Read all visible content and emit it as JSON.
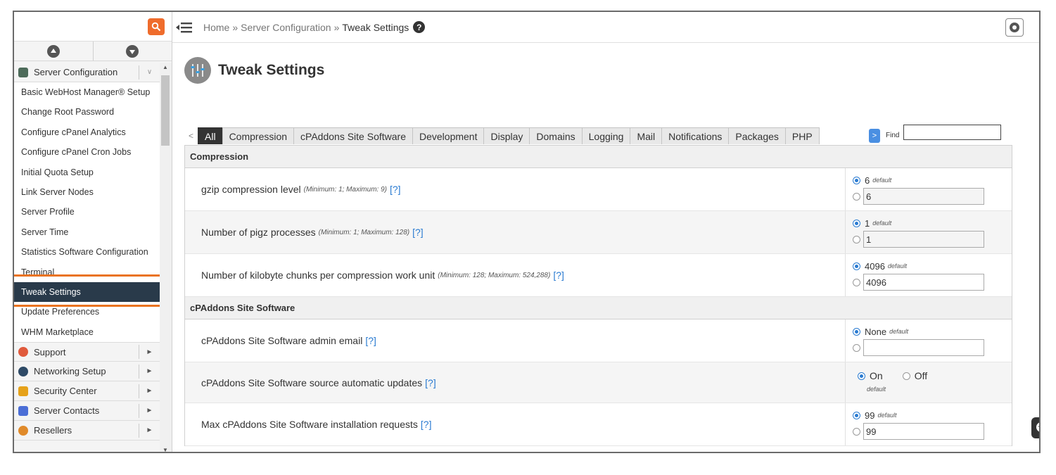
{
  "sidebar": {
    "search_placeholder": "",
    "category_open": "Server Configuration",
    "items": [
      "Basic WebHost Manager® Setup",
      "Change Root Password",
      "Configure cPanel Analytics",
      "Configure cPanel Cron Jobs",
      "Initial Quota Setup",
      "Link Server Nodes",
      "Server Profile",
      "Server Time",
      "Statistics Software Configuration",
      "Terminal",
      "Tweak Settings",
      "Update Preferences",
      "WHM Marketplace"
    ],
    "active_item": "Tweak Settings",
    "categories": [
      "Support",
      "Networking Setup",
      "Security Center",
      "Server Contacts",
      "Resellers"
    ]
  },
  "breadcrumb": {
    "home": "Home",
    "separator": "»",
    "level1": "Server Configuration",
    "current": "Tweak Settings"
  },
  "page": {
    "title": "Tweak Settings"
  },
  "tabs": {
    "items": [
      "All",
      "Compression",
      "cPAddons Site Software",
      "Development",
      "Display",
      "Domains",
      "Logging",
      "Mail",
      "Notifications",
      "Packages",
      "PHP"
    ],
    "active": "All",
    "find_label": "Find",
    "find_value": "",
    "prev_glyph": "<",
    "next_glyph": ">"
  },
  "sections": [
    {
      "title": "Compression",
      "rows": [
        {
          "label": "gzip compression level",
          "hint": "(Minimum: 1; Maximum: 9)",
          "help": "[?]",
          "default_value": "6",
          "default_tag": "default",
          "input_value": "6"
        },
        {
          "label": "Number of pigz processes",
          "hint": "(Minimum: 1; Maximum: 128)",
          "help": "[?]",
          "default_value": "1",
          "default_tag": "default",
          "input_value": "1"
        },
        {
          "label": "Number of kilobyte chunks per compression work unit",
          "hint": "(Minimum: 128; Maximum: 524,288)",
          "help": "[?]",
          "default_value": "4096",
          "default_tag": "default",
          "input_value": "4096"
        }
      ]
    },
    {
      "title": "cPAddons Site Software",
      "rows": [
        {
          "label": "cPAddons Site Software admin email",
          "help": "[?]",
          "default_value": "None",
          "default_tag": "default",
          "input_value": ""
        },
        {
          "label": "cPAddons Site Software source automatic updates",
          "help": "[?]",
          "on_label": "On",
          "off_label": "Off",
          "default_tag": "default"
        },
        {
          "label": "Max cPAddons Site Software installation requests",
          "help": "[?]",
          "default_value": "99",
          "default_tag": "default",
          "input_value": "99"
        }
      ]
    }
  ],
  "colors": {
    "accent": "#ef6c2c",
    "active_nav": "#293a4a",
    "link": "#2a7bd1",
    "highlight": "#ea7320"
  }
}
